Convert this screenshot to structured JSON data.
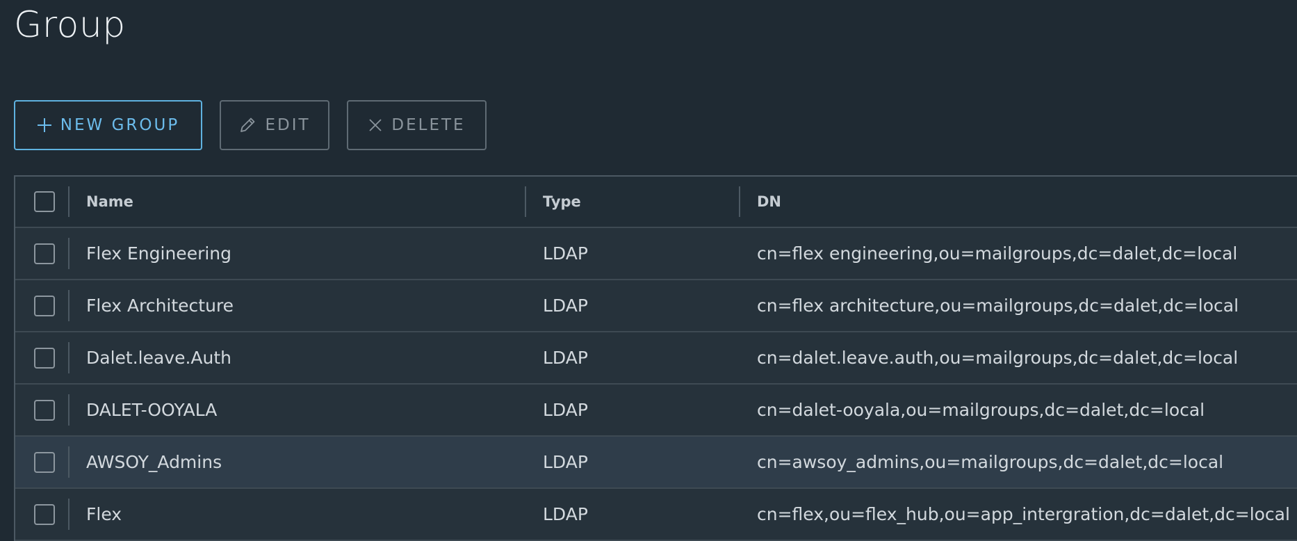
{
  "page": {
    "title": "Group"
  },
  "toolbar": {
    "new_label": "NEW GROUP",
    "edit_label": "EDIT",
    "delete_label": "DELETE"
  },
  "table": {
    "columns": {
      "name": "Name",
      "type": "Type",
      "dn": "DN"
    },
    "rows": [
      {
        "name": "Flex Engineering",
        "type": "LDAP",
        "dn": "cn=flex engineering,ou=mailgroups,dc=dalet,dc=local"
      },
      {
        "name": "Flex Architecture",
        "type": "LDAP",
        "dn": "cn=flex architecture,ou=mailgroups,dc=dalet,dc=local"
      },
      {
        "name": "Dalet.leave.Auth",
        "type": "LDAP",
        "dn": "cn=dalet.leave.auth,ou=mailgroups,dc=dalet,dc=local"
      },
      {
        "name": "DALET-OOYALA",
        "type": "LDAP",
        "dn": "cn=dalet-ooyala,ou=mailgroups,dc=dalet,dc=local"
      },
      {
        "name": "AWSOY_Admins",
        "type": "LDAP",
        "dn": "cn=awsoy_admins,ou=mailgroups,dc=dalet,dc=local"
      },
      {
        "name": "Flex",
        "type": "LDAP",
        "dn": "cn=flex,ou=flex_hub,ou=app_intergration,dc=dalet,dc=local"
      }
    ]
  },
  "icons": {
    "new": "plus-icon",
    "edit": "pencil-icon",
    "delete": "close-icon"
  },
  "colors": {
    "background": "#1f2a33",
    "accent": "#6cbcec",
    "row_hover": "#2f3d4a"
  }
}
